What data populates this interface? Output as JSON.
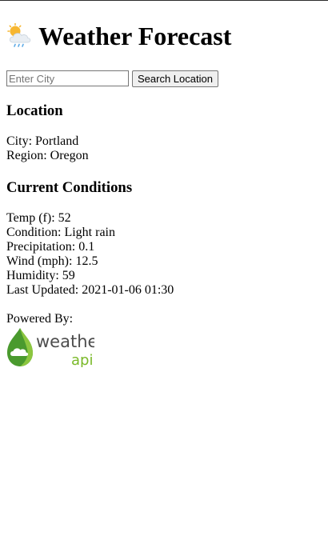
{
  "header": {
    "icon": "sun-cloud-rain-icon",
    "title": "Weather Forecast"
  },
  "search": {
    "placeholder": "Enter City",
    "value": "",
    "button_label": "Search Location"
  },
  "location": {
    "heading": "Location",
    "city_label": "City:",
    "city": "Portland",
    "region_label": "Region:",
    "region": "Oregon"
  },
  "conditions": {
    "heading": "Current Conditions",
    "temp_label": "Temp (f):",
    "temp": "52",
    "condition_label": "Condition:",
    "condition": "Light rain",
    "precip_label": "Precipitation:",
    "precip": "0.1",
    "wind_label": "Wind (mph):",
    "wind": "12.5",
    "humidity_label": "Humidity:",
    "humidity": "59",
    "updated_label": "Last Updated:",
    "updated": "2021-01-06 01:30"
  },
  "footer": {
    "powered_by": "Powered By:",
    "logo_text_1": "weather",
    "logo_text_2": "api",
    "logo_colors": {
      "drop_dark": "#4a9a2e",
      "drop_light": "#8cc63f",
      "text_gray": "#4d4d4d",
      "text_green": "#7ab929"
    }
  }
}
